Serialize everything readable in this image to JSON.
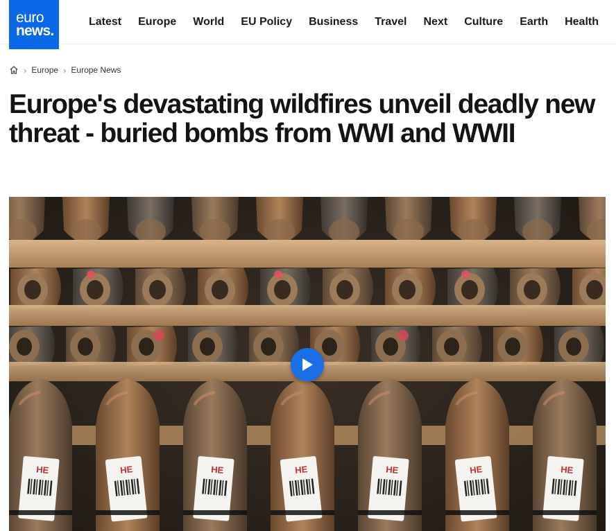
{
  "site": {
    "logo_line1": "euro",
    "logo_line2": "news",
    "brand_color": "#0a67e5"
  },
  "nav": {
    "items": [
      {
        "label": "Latest"
      },
      {
        "label": "Europe"
      },
      {
        "label": "World"
      },
      {
        "label": "EU Policy"
      },
      {
        "label": "Business"
      },
      {
        "label": "Travel"
      },
      {
        "label": "Next"
      },
      {
        "label": "Culture"
      },
      {
        "label": "Earth"
      },
      {
        "label": "Health"
      }
    ]
  },
  "breadcrumb": {
    "home_icon": "home-icon",
    "items": [
      {
        "label": "Europe"
      },
      {
        "label": "Europe News"
      }
    ]
  },
  "article": {
    "title": "Europe's devastating wildfires unveil deadly new threat - buried bombs from WWI and WWII"
  },
  "hero": {
    "shell_tag_text": "HE",
    "play_icon": "play-icon",
    "play_color": "#1b6fe6"
  }
}
